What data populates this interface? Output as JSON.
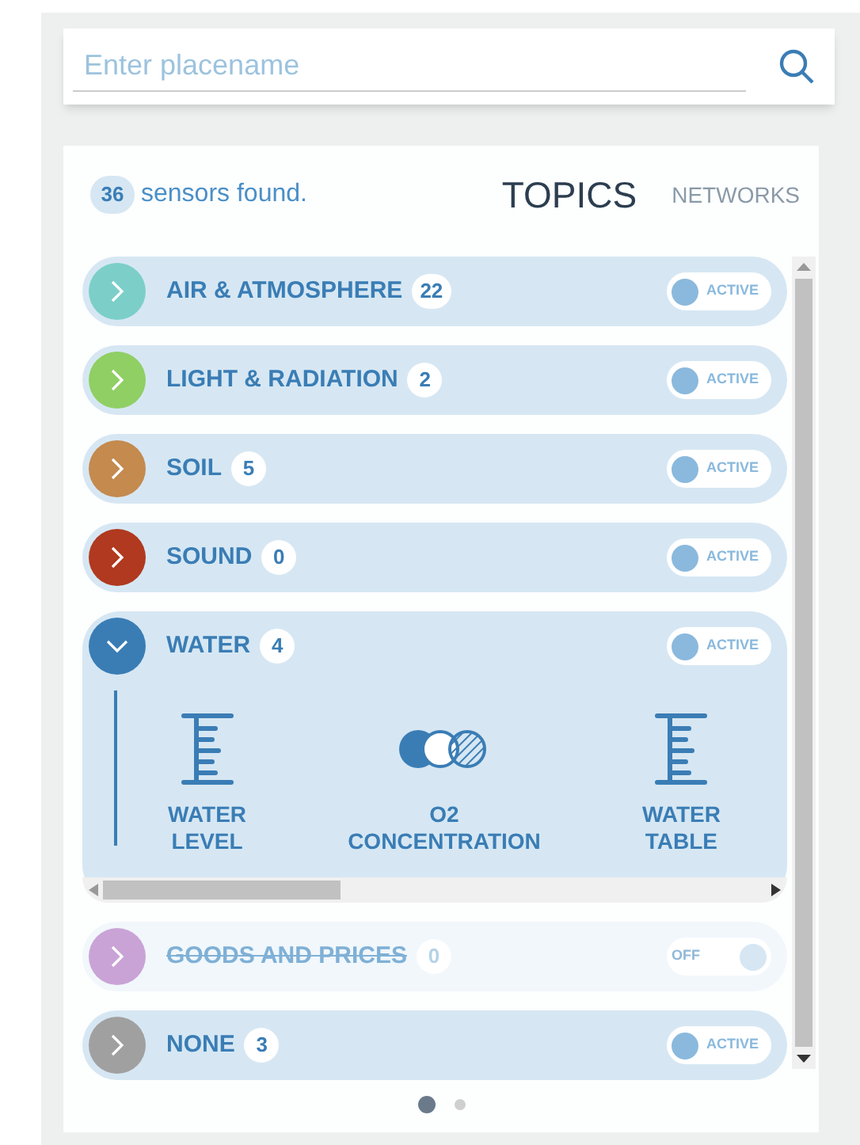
{
  "search": {
    "placeholder": "Enter placename"
  },
  "summary": {
    "count": "36",
    "text": "sensors found."
  },
  "tabs": [
    {
      "label": "TOPICS",
      "selected": true
    },
    {
      "label": "NETWORKS",
      "selected": false
    }
  ],
  "topics": [
    {
      "name": "AIR & ATMOSPHERE",
      "count": "22",
      "color": "#7ccfc9",
      "on": true,
      "expanded": false,
      "toggle_label": "ACTIVE"
    },
    {
      "name": "LIGHT & RADIATION",
      "count": "2",
      "color": "#8fcf63",
      "on": true,
      "expanded": false,
      "toggle_label": "ACTIVE"
    },
    {
      "name": "SOIL",
      "count": "5",
      "color": "#c48a4e",
      "on": true,
      "expanded": false,
      "toggle_label": "ACTIVE"
    },
    {
      "name": "SOUND",
      "count": "0",
      "color": "#b0391f",
      "on": true,
      "expanded": false,
      "toggle_label": "ACTIVE"
    },
    {
      "name": "WATER",
      "count": "4",
      "color": "#3a7db5",
      "on": true,
      "expanded": true,
      "toggle_label": "ACTIVE",
      "sensors": [
        {
          "kind": "gauge",
          "label": "WATER LEVEL"
        },
        {
          "kind": "circles",
          "label": "O2 CONCENTRATION"
        },
        {
          "kind": "gauge",
          "label": "WATER TABLE"
        }
      ]
    },
    {
      "name": "GOODS AND PRICES",
      "count": "0",
      "color": "#c9a3d6",
      "on": false,
      "expanded": false,
      "toggle_label": "OFF"
    },
    {
      "name": "NONE",
      "count": "3",
      "color": "#a0a0a0",
      "on": true,
      "expanded": false,
      "toggle_label": "ACTIVE"
    }
  ],
  "pager": [
    {
      "selected": true
    },
    {
      "selected": false
    }
  ]
}
